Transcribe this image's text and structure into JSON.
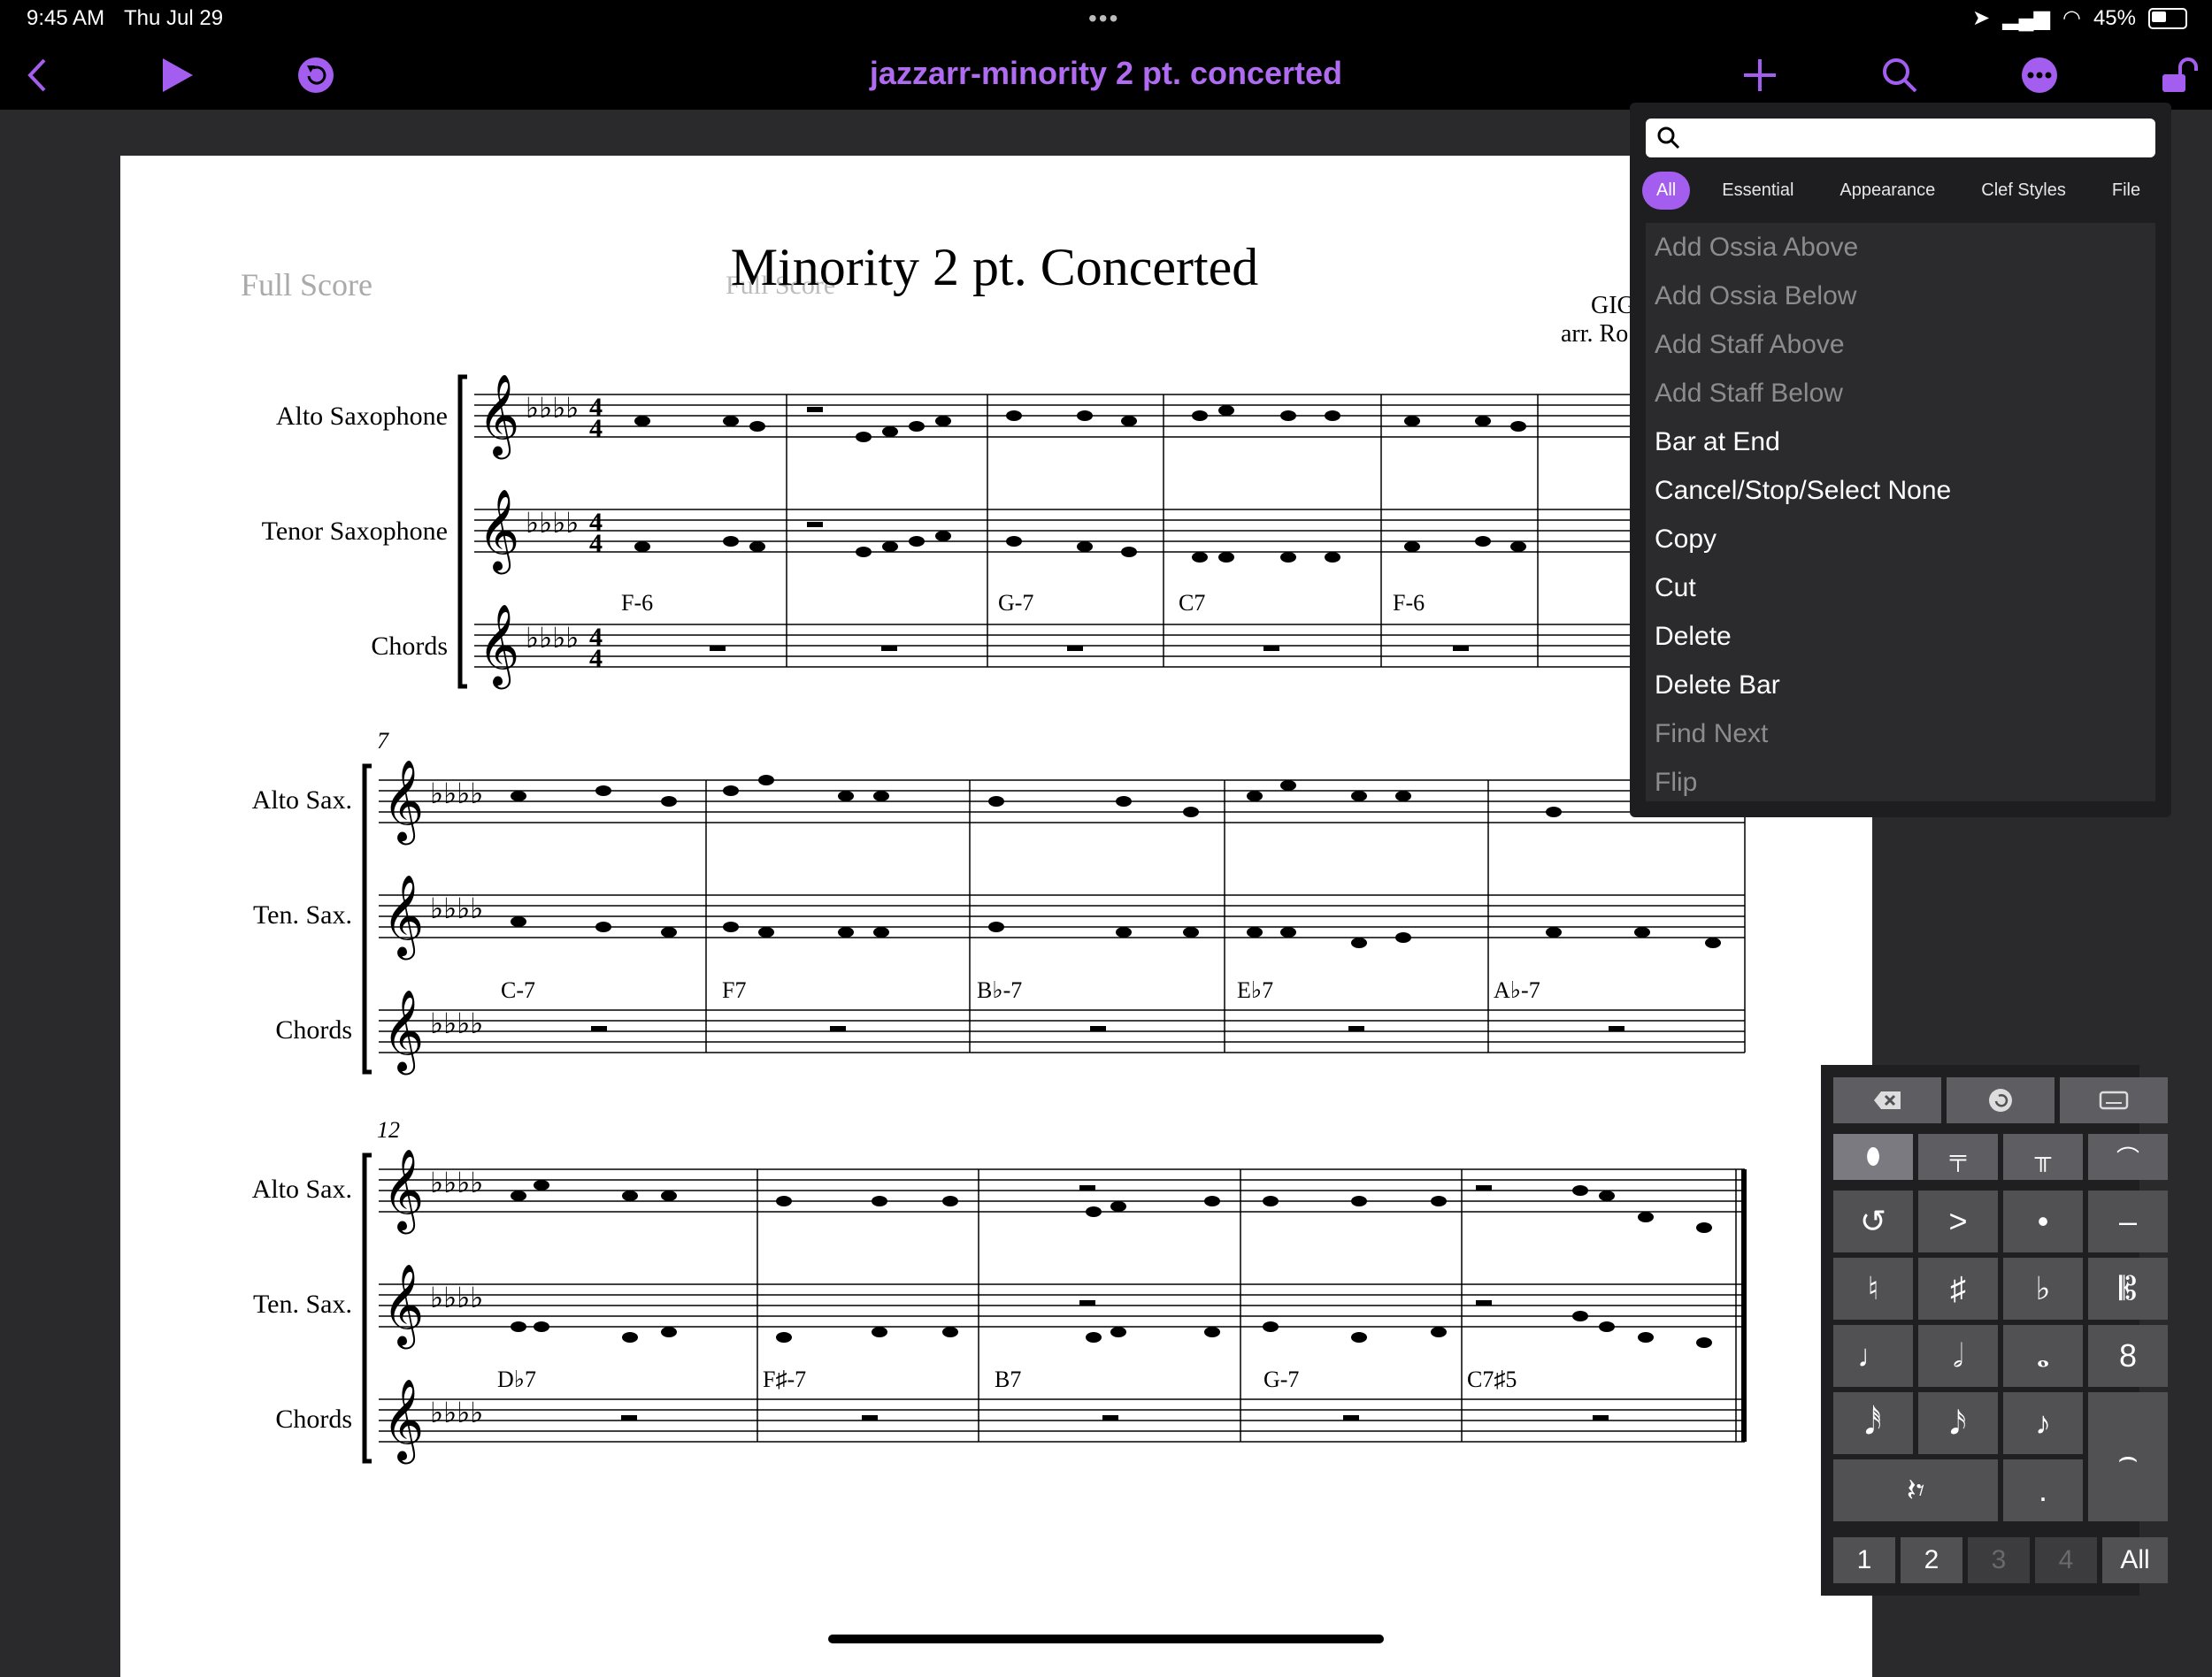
{
  "status_bar": {
    "time": "9:45 AM",
    "date": "Thu Jul 29",
    "battery": "45%"
  },
  "toolbar": {
    "title": "jazzarr-minority 2 pt. concerted"
  },
  "score": {
    "header_left": "Full Score",
    "title": "Minority 2 pt. Concerted",
    "header_ghost": "Full Score",
    "composer": "GIG",
    "arranger": "arr. Ro",
    "systems": [
      {
        "measure_number": "",
        "staves": [
          "Alto Saxophone",
          "Tenor Saxophone",
          "Chords"
        ],
        "chords": [
          "F-6",
          "G-7",
          "C7",
          "F-6"
        ]
      },
      {
        "measure_number": "7",
        "staves": [
          "Alto Sax.",
          "Ten. Sax.",
          "Chords"
        ],
        "chords": [
          "C-7",
          "F7",
          "B♭-7",
          "E♭7",
          "A♭-7"
        ]
      },
      {
        "measure_number": "12",
        "staves": [
          "Alto Sax.",
          "Ten. Sax.",
          "Chords"
        ],
        "chords": [
          "D♭7",
          "F♯-7",
          "B7",
          "G-7",
          "C7♯5"
        ]
      }
    ]
  },
  "menu": {
    "search_placeholder": "",
    "tabs": [
      "All",
      "Essential",
      "Appearance",
      "Clef Styles",
      "File"
    ],
    "active_tab": "All",
    "items": [
      {
        "label": "Add Ossia Above",
        "enabled": false
      },
      {
        "label": "Add Ossia Below",
        "enabled": false
      },
      {
        "label": "Add Staff Above",
        "enabled": false
      },
      {
        "label": "Add Staff Below",
        "enabled": false
      },
      {
        "label": "Bar at End",
        "enabled": true
      },
      {
        "label": "Cancel/Stop/Select None",
        "enabled": true
      },
      {
        "label": "Copy",
        "enabled": true
      },
      {
        "label": "Cut",
        "enabled": true
      },
      {
        "label": "Delete",
        "enabled": true
      },
      {
        "label": "Delete Bar",
        "enabled": true
      },
      {
        "label": "Find Next",
        "enabled": false
      },
      {
        "label": "Flip",
        "enabled": false
      }
    ]
  },
  "keypad": {
    "voices": [
      "1",
      "2",
      "3",
      "4",
      "All"
    ],
    "glyphs": {
      "accent": ">",
      "staccato": "•",
      "tenuto": "–",
      "natural": "♮",
      "sharp": "♯",
      "flat": "♭",
      "quarter": "♩",
      "half": "𝅗𝅥",
      "whole": "𝅝",
      "eighth": "♪",
      "sixteenth": "𝅘𝅥𝅯",
      "thirtysecond": "𝅘𝅥𝅰",
      "rest": "𝄽𝄾",
      "dot": ".",
      "tie": "⌢",
      "octave": "8",
      "double_flat": "𝄫"
    }
  },
  "colors": {
    "accent": "#a35ef0",
    "title": "#b06cf0"
  }
}
